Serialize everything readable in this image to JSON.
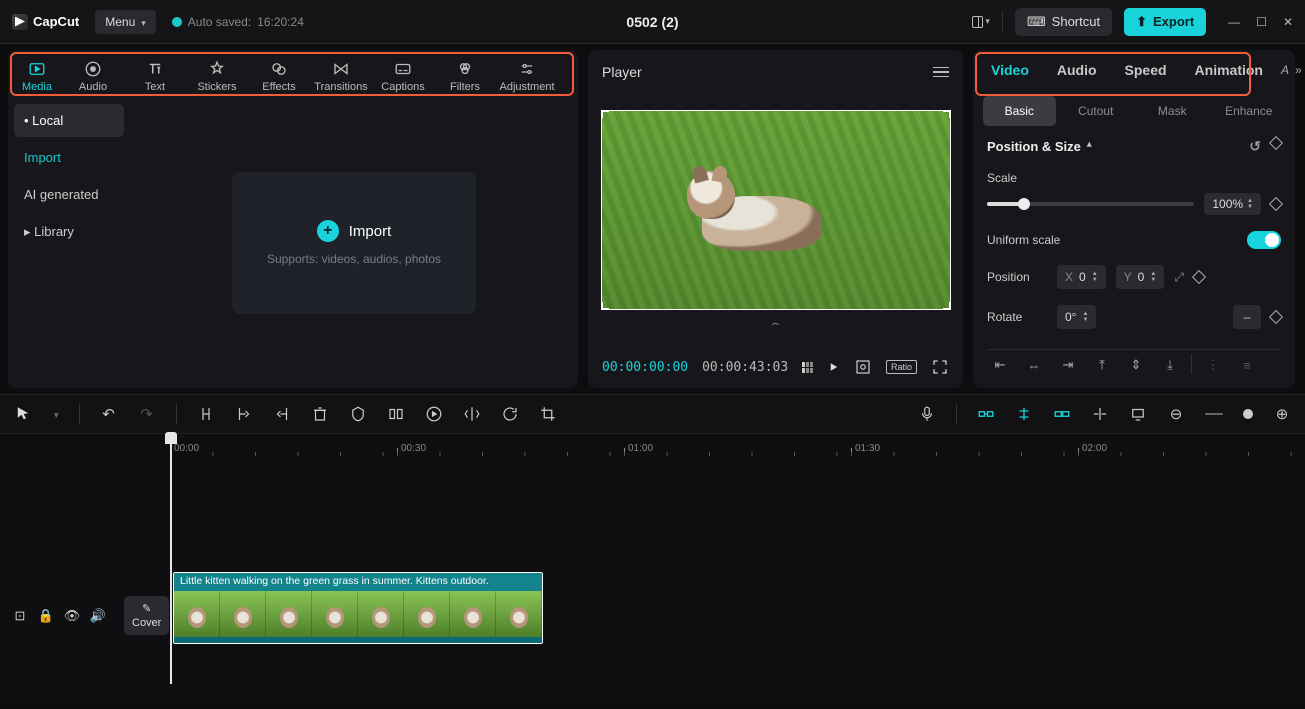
{
  "app": {
    "name": "CapCut",
    "menu_label": "Menu",
    "autosave_prefix": "Auto saved:",
    "autosave_time": "16:20:24",
    "project_title": "0502 (2)"
  },
  "titlebar_right": {
    "shortcut": "Shortcut",
    "export": "Export"
  },
  "categories": [
    {
      "id": "media",
      "label": "Media",
      "active": true
    },
    {
      "id": "audio",
      "label": "Audio"
    },
    {
      "id": "text",
      "label": "Text"
    },
    {
      "id": "stickers",
      "label": "Stickers"
    },
    {
      "id": "effects",
      "label": "Effects"
    },
    {
      "id": "transitions",
      "label": "Transitions"
    },
    {
      "id": "captions",
      "label": "Captions"
    },
    {
      "id": "filters",
      "label": "Filters"
    },
    {
      "id": "adjustment",
      "label": "Adjustment"
    }
  ],
  "media_side": {
    "local": "Local",
    "import": "Import",
    "ai": "AI generated",
    "library": "Library"
  },
  "import_box": {
    "title": "Import",
    "subtitle": "Supports: videos, audios, photos"
  },
  "player": {
    "title": "Player",
    "current": "00:00:00:00",
    "duration": "00:00:43:03",
    "ratio": "Ratio"
  },
  "inspector": {
    "tabs": [
      "Video",
      "Audio",
      "Speed",
      "Animation"
    ],
    "subtabs": [
      "Basic",
      "Cutout",
      "Mask",
      "Enhance"
    ],
    "section": "Position & Size",
    "scale_label": "Scale",
    "scale_value": "100%",
    "uniform_label": "Uniform scale",
    "position_label": "Position",
    "x_label": "X",
    "x_val": "0",
    "y_label": "Y",
    "y_val": "0",
    "rotate_label": "Rotate",
    "rotate_val": "0°",
    "dash": "–"
  },
  "ruler": [
    "00:00",
    "00:30",
    "01:00",
    "01:30",
    "02:00"
  ],
  "cover_label": "Cover",
  "clip": {
    "name": "Little kitten walking on the green grass in summer. Kittens outdoor."
  }
}
